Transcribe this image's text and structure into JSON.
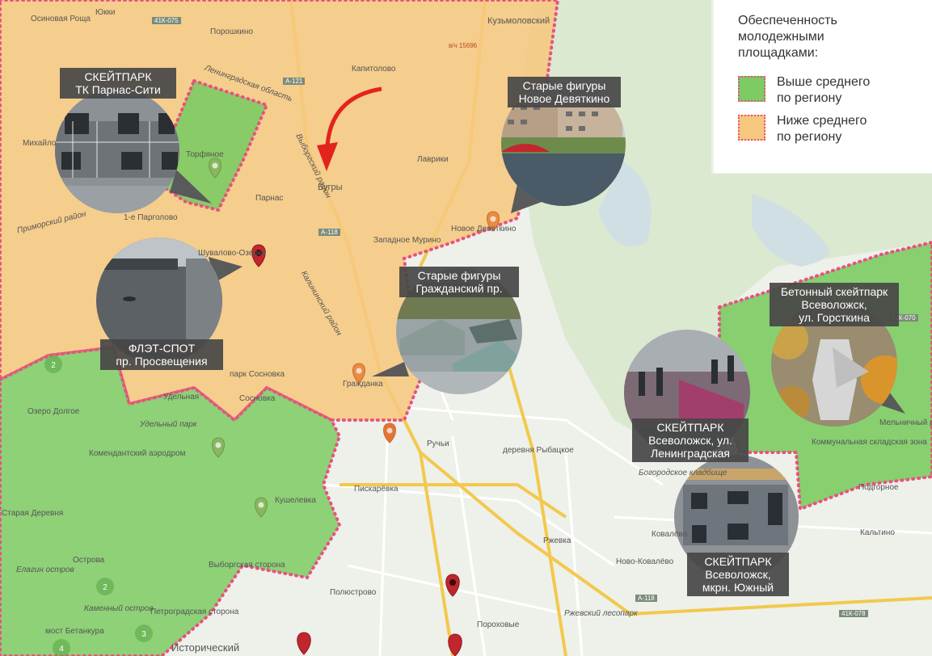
{
  "legend": {
    "title": "Обеспеченность\nмолодежными\nплощадками:",
    "items": [
      {
        "label": "Выше среднего\nпо региону",
        "color": "#7ccb63"
      },
      {
        "label": "Ниже среднего\nпо региону",
        "color": "#f6c77e"
      }
    ]
  },
  "spots": [
    {
      "label": "СКЕЙТПАРК\nТК Парнас-Сити"
    },
    {
      "label": "Старые фигуры\nНовое Девяткино"
    },
    {
      "label": "ФЛЭТ-СПОТ\nпр. Просвещения"
    },
    {
      "label": "Старые фигуры\nГражданский пр."
    },
    {
      "label": "Бетонный скейтпарк\nВсеволожск,\nул. Горсткина"
    },
    {
      "label": "СКЕЙТПАРК\nВсеволожск, ул.\nЛенинградская"
    },
    {
      "label": "СКЕЙТПАРК\nВсеволожск,\nмкрн. Южный"
    }
  ],
  "places": [
    "Осиновая Роща",
    "Юкки",
    "Порошкино",
    "Кузьмоловский",
    "Капитолово",
    "Торфяное",
    "Михайло",
    "Парнас",
    "Бугры",
    "Лаврики",
    "1-е Парголово",
    "Шувалово-Озерки",
    "Западное Мурино",
    "Новое Девяткино",
    "Гражданка",
    "парк Сосновка",
    "Сосновка",
    "Удельная",
    "Озеро Долгое",
    "Удельный парк",
    "Комендантский аэродром",
    "Ручьи",
    "деревня Рыбацкое",
    "Пискарёвка",
    "Кушелевка",
    "Старая Деревня",
    "Ржевка",
    "Ковалёво",
    "Ново-Ковалёво",
    "Выборгская сторона",
    "Полюстрово",
    "Пороховые",
    "Ржевский лесопарк",
    "Петроградская сторона",
    "Каменный остров",
    "Елагин остров",
    "Острова",
    "мост Бетанкура",
    "Исторический",
    "Мельничный ручей",
    "Коммунальная складская зона",
    "Кальтино",
    "Подгорное",
    "Богородское кладбище",
    "Приморский район",
    "Выборгский район",
    "Ленинградская область",
    "Калининский район"
  ],
  "roads": [
    "41К-075",
    "А-121",
    "А-118",
    "41К-070",
    "41К-078",
    "А-118",
    "в/ч 15696"
  ],
  "cluster_counts": [
    "2",
    "2",
    "3",
    "4"
  ]
}
